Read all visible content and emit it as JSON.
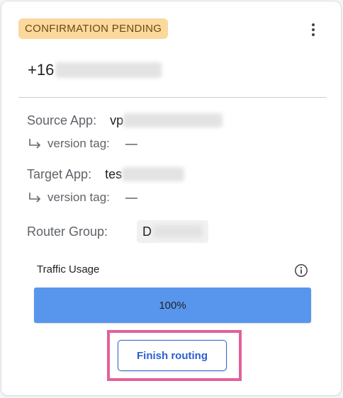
{
  "card": {
    "status_badge": "CONFIRMATION PENDING",
    "menu_icon": "more-vertical-icon",
    "phone_prefix": "+16"
  },
  "details": {
    "source_app_label": "Source App:",
    "source_app_value_visible": "vp",
    "source_version_label": "version tag:",
    "source_version_value": "—",
    "target_app_label": "Target App:",
    "target_app_value_visible": "tes",
    "target_version_label": "version tag:",
    "target_version_value": "—",
    "router_group_label": "Router Group:",
    "router_group_value_visible": "D"
  },
  "traffic": {
    "label": "Traffic Usage",
    "info_icon": "info-icon",
    "percent_text": "100%",
    "fraction": 1.0
  },
  "actions": {
    "finish_label": "Finish routing"
  },
  "colors": {
    "badge_bg": "#fbd89c",
    "badge_text": "#6b4a12",
    "progress_fill": "#5896ee",
    "button_accent": "#2a5fd0",
    "highlight": "#e3609a"
  }
}
